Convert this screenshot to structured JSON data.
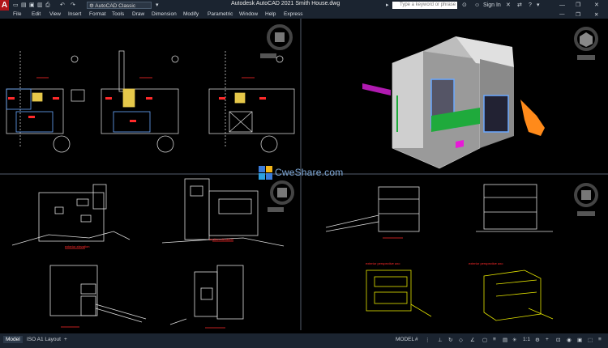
{
  "app": {
    "logo": "A",
    "workspace": "AutoCAD Classic",
    "title": "Autodesk AutoCAD 2021   Smith House.dwg"
  },
  "search": {
    "placeholder": "Type a keyword or phrase"
  },
  "account": {
    "sign_in": "Sign In"
  },
  "menu": [
    "File",
    "Edit",
    "View",
    "Insert",
    "Format",
    "Tools",
    "Draw",
    "Dimension",
    "Modify",
    "Parametric",
    "Window",
    "Help",
    "Express"
  ],
  "status": {
    "tabs": [
      "Model",
      "ISO A1 Layout"
    ],
    "add": "+",
    "model_button": "MODEL",
    "scale": "1:1"
  },
  "watermark": {
    "text": "CweShare.com"
  },
  "drawing_labels": {
    "elev_left": "exterior elevation",
    "elev_right": "section elevation",
    "persp_left": "exterior perspective axo",
    "persp_right": "exterior perspective axo"
  },
  "colors": {
    "chrome": "#1b2430",
    "accent": "#b0141a",
    "yellow": "#e6e600",
    "red": "#ff2a2a"
  }
}
